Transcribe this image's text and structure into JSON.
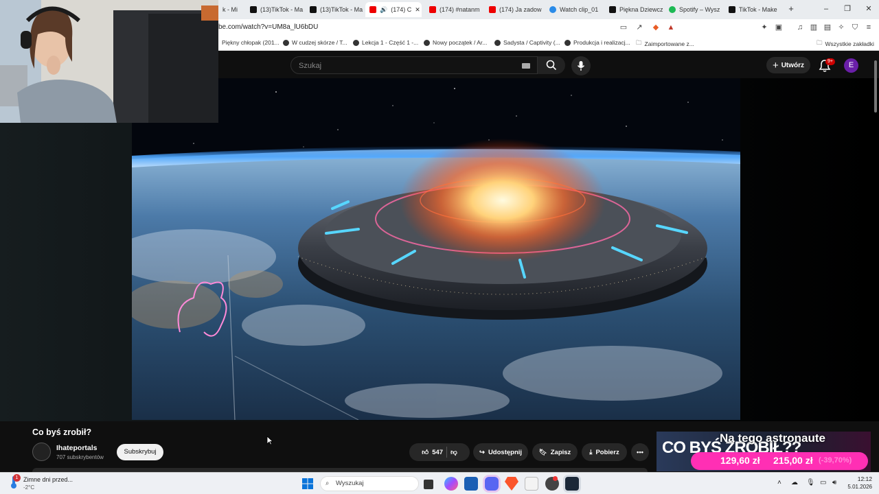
{
  "browser": {
    "tabs": [
      {
        "label": "k - Mi",
        "icon": "tiktok-icon"
      },
      {
        "label": "(13)TikTok - Ma",
        "icon": "tiktok-icon"
      },
      {
        "label": "(13)TikTok - Ma",
        "icon": "tiktok-icon"
      },
      {
        "label": "(174) C",
        "icon": "youtube-icon",
        "active": true
      },
      {
        "label": "(174) #natanm",
        "icon": "youtube-icon"
      },
      {
        "label": "(174) Ja zadow",
        "icon": "youtube-icon"
      },
      {
        "label": "Watch clip_01",
        "icon": "clip-icon"
      },
      {
        "label": "Piękna Dziewcz",
        "icon": "tiktok-icon"
      },
      {
        "label": "Spotify – Wysz",
        "icon": "spotify-icon"
      },
      {
        "label": "TikTok - Make",
        "icon": "tiktok-icon"
      }
    ],
    "new_tab": "+",
    "url": "be.com/watch?v=UM8a_lU6bDU",
    "ext_badge": "1",
    "bookmarks": [
      "Piękny chłopak (201...",
      "W cudzej skórze / T...",
      "Lekcja 1 - Część 1 -...",
      "Nowy początek / Ar...",
      "Sadysta / Captivity (...",
      "Produkcja i realizacj...",
      "Zaimportowane z..."
    ],
    "all_bookmarks": "Wszystkie zakładki"
  },
  "youtube": {
    "search_placeholder": "Szukaj",
    "create_label": "Utwórz",
    "notif_badge": "9+",
    "avatar_letter": "E"
  },
  "video": {
    "title": "Co byś zrobił?",
    "channel": "Ihateportals",
    "subscribers": "707 subskrybentów",
    "subscribe": "Subskrybuj",
    "likes": "547",
    "share": "Udostępnij",
    "save": "Zapisz",
    "download": "Pobierz"
  },
  "ad": {
    "headline": "Na tego astronaute",
    "overlay": "CO BYŚ ZROBIŁ??",
    "price_new": "129,60 zł",
    "price_old": "215,00 zł",
    "discount": "(-39,70%)"
  },
  "taskbar": {
    "weather_title": "Zimne dni przed...",
    "weather_temp": "-2°C",
    "weather_badge": "1",
    "search_placeholder": "Wyszukaj",
    "time": "12:12",
    "date": "5.01.2026"
  },
  "colors": {
    "yt_bg": "#0f0f0f",
    "accent_red": "#cc0000",
    "avatar_purple": "#6a1fa8",
    "ad_pink": "#ff2fb4"
  }
}
